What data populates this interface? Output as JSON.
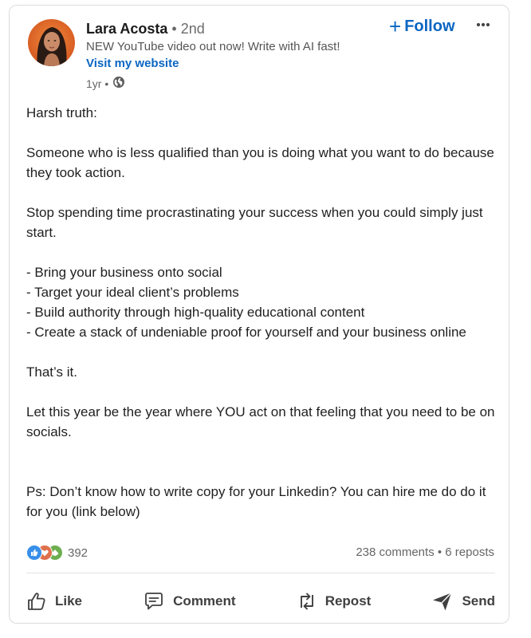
{
  "author": {
    "name": "Lara Acosta",
    "degree": "• 2nd",
    "headline": "NEW YouTube video out now! Write with AI fast!",
    "website_link": "Visit my website",
    "time": "1yr •",
    "visibility_icon": "globe-icon"
  },
  "header_actions": {
    "follow_label": "Follow",
    "more_icon": "more-options-icon"
  },
  "post": {
    "paragraphs": [
      "Harsh truth:",
      "Someone who is less qualified than you is doing what you want to do because they took action.",
      "Stop spending time procrastinating your success when you could simply just start.",
      "- Bring your business onto social\n- Target your ideal client’s problems\n- Build authority through high-quality educational content\n- Create a stack of undeniable proof for yourself and your business online",
      "That’s it.",
      "Let this year be the year where YOU act on that feeling that you need to be on socials.",
      "Ps: Don’t know how to write copy for your Linkedin? You can hire me do do it for you (link below)"
    ]
  },
  "social": {
    "reaction_count": "392",
    "comments": "238 comments",
    "separator": " • ",
    "reposts": "6 reposts",
    "reaction_icons": [
      "like-reaction-icon",
      "love-reaction-icon",
      "support-reaction-icon"
    ]
  },
  "action_bar": {
    "like_label": "Like",
    "comment_label": "Comment",
    "repost_label": "Repost",
    "send_label": "Send"
  },
  "colors": {
    "link_blue": "#0a66c2",
    "text_dark": "#1f1f1f",
    "text_muted": "#666666"
  }
}
